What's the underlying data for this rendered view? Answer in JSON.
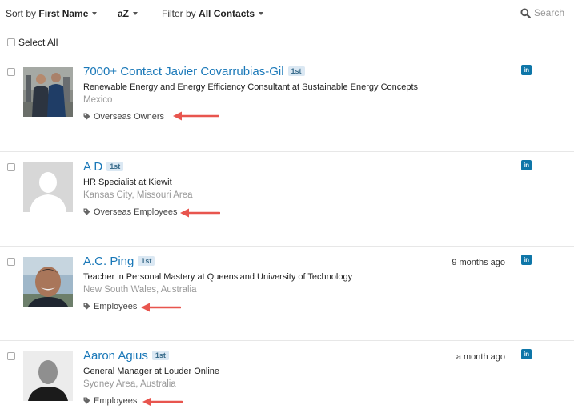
{
  "toolbar": {
    "sort_prefix": "Sort by",
    "sort_value": "First Name",
    "order_label": "aZ",
    "filter_prefix": "Filter by",
    "filter_value": "All Contacts",
    "search_placeholder": "Search"
  },
  "select_all_label": "Select All",
  "colors": {
    "link": "#1a78b8",
    "degree_bg": "#dbe8f3",
    "linkedin": "#0e76a8",
    "arrow": "#e8554e"
  },
  "contacts": [
    {
      "name": "7000+ Contact Javier Covarrubias-Gil",
      "degree": "1st",
      "headline": "Renewable Energy and Energy Efficiency Consultant at Sustainable Energy Concepts",
      "location": "Mexico",
      "tag": "Overseas Owners",
      "time": "",
      "linkedin": "in"
    },
    {
      "name": "A D",
      "degree": "1st",
      "headline": "HR Specialist at Kiewit",
      "location": "Kansas City, Missouri Area",
      "tag": "Overseas Employees",
      "time": "",
      "linkedin": "in"
    },
    {
      "name": "A.C. Ping",
      "degree": "1st",
      "headline": "Teacher in Personal Mastery at Queensland University of Technology",
      "location": "New South Wales, Australia",
      "tag": "Employees",
      "time": "9 months ago",
      "linkedin": "in"
    },
    {
      "name": "Aaron Agius",
      "degree": "1st",
      "headline": "General Manager at Louder Online",
      "location": "Sydney Area, Australia",
      "tag": "Employees",
      "time": "a month ago",
      "linkedin": "in"
    }
  ]
}
